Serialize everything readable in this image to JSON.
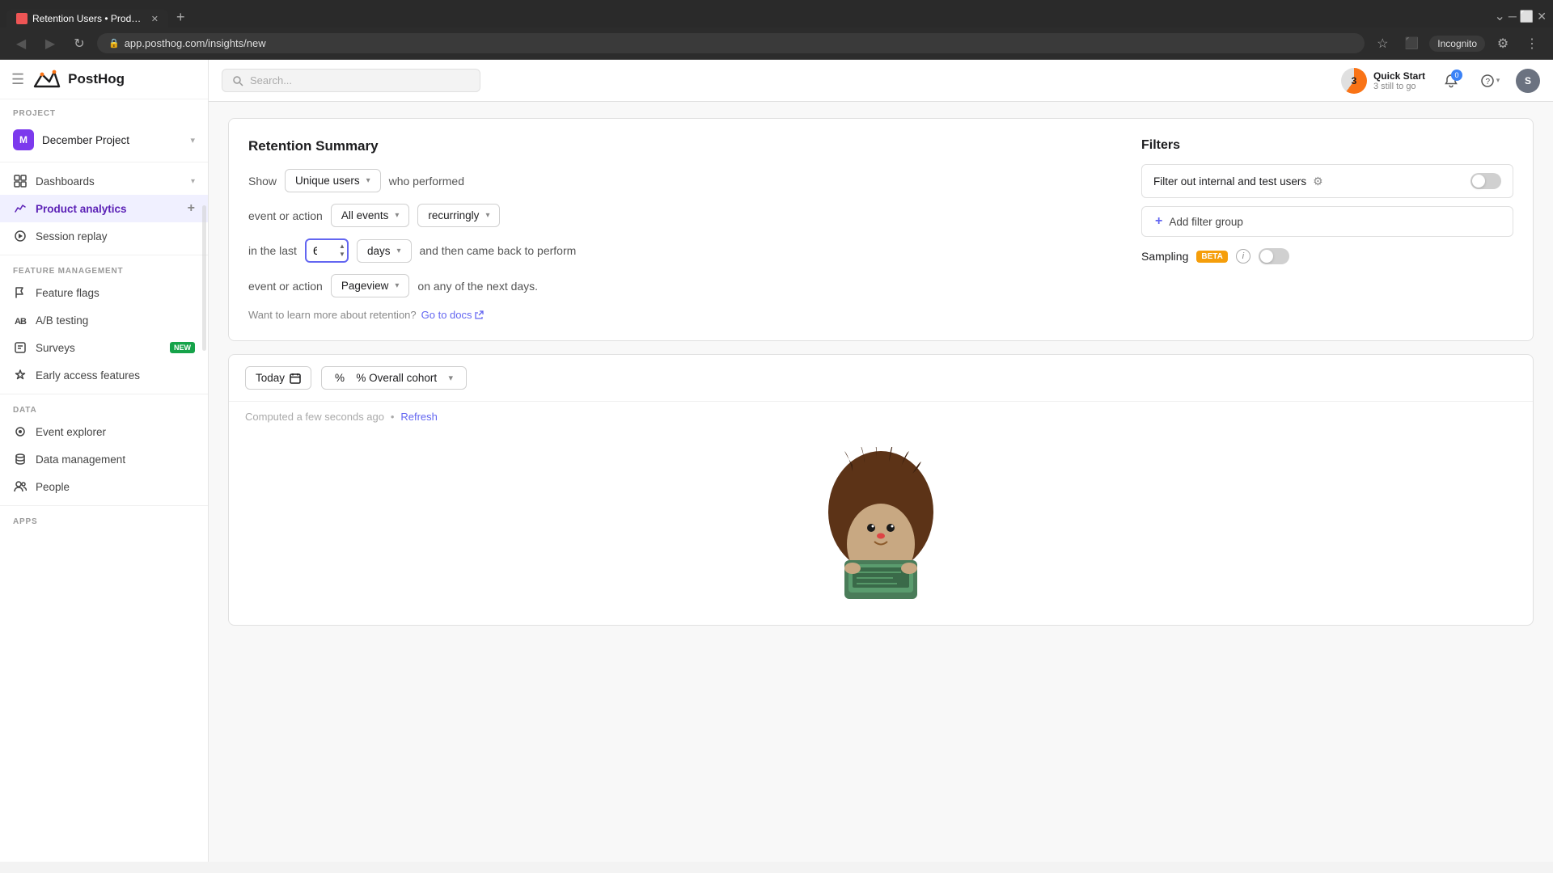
{
  "browser": {
    "tab_title": "Retention Users • Product analy",
    "tab_favicon": "🦔",
    "new_tab_symbol": "+",
    "address": "app.posthog.com/insights/new",
    "incognito_label": "Incognito"
  },
  "header": {
    "logo_text": "PostHog",
    "search_placeholder": "Search...",
    "quick_start_label": "Quick Start",
    "quick_start_sub": "3 still to go",
    "quick_start_number": "3",
    "notification_count": "0",
    "avatar_letter": "S"
  },
  "sidebar": {
    "menu_sections": [
      {
        "label": "PROJECT"
      }
    ],
    "project_name": "December Project",
    "project_letter": "M",
    "nav_items": [
      {
        "id": "dashboards",
        "label": "Dashboards",
        "has_chevron": true
      },
      {
        "id": "product-analytics",
        "label": "Product analytics",
        "active": true,
        "has_plus": true
      },
      {
        "id": "session-replay",
        "label": "Session replay"
      }
    ],
    "feature_management_label": "FEATURE MANAGEMENT",
    "feature_items": [
      {
        "id": "feature-flags",
        "label": "Feature flags"
      },
      {
        "id": "ab-testing",
        "label": "A/B testing"
      },
      {
        "id": "surveys",
        "label": "Surveys",
        "badge": "NEW"
      },
      {
        "id": "early-access",
        "label": "Early access features"
      }
    ],
    "data_label": "DATA",
    "data_items": [
      {
        "id": "event-explorer",
        "label": "Event explorer"
      },
      {
        "id": "data-management",
        "label": "Data management"
      },
      {
        "id": "people",
        "label": "People"
      }
    ],
    "apps_label": "APPS"
  },
  "retention": {
    "title": "Retention Summary",
    "show_label": "Show",
    "unique_users_label": "Unique users",
    "who_performed_label": "who performed",
    "event_or_action_label": "event or action",
    "all_events_label": "All events",
    "recurringly_label": "recurringly",
    "in_the_last_label": "in the last",
    "days_value": "6",
    "days_label": "days",
    "and_then_label": "and then came back to perform",
    "event_or_action2_label": "event or action",
    "pageview_label": "Pageview",
    "on_any_label": "on any of the next days.",
    "docs_text": "Want to learn more about retention?",
    "docs_link": "Go to docs",
    "docs_url": "#"
  },
  "filters": {
    "title": "Filters",
    "filter_internal_label": "Filter out internal and test users",
    "add_filter_group_label": "Add filter group",
    "sampling_label": "Sampling",
    "beta_label": "BETA"
  },
  "chart_area": {
    "today_label": "Today",
    "cohort_label": "% Overall cohort",
    "computed_text": "Computed a few seconds ago",
    "bullet": "•",
    "refresh_label": "Refresh"
  }
}
